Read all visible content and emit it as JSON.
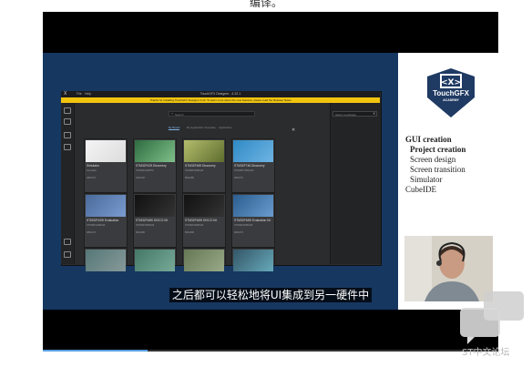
{
  "top_caption": "编译。",
  "video": {
    "progress": 0.23
  },
  "app": {
    "title": "TouchGFX Designer - 4.22.1",
    "logo": "X",
    "menu": [
      "File",
      "Help"
    ],
    "banner": "Thanks for installing TouchGFX Designer 4.22. To learn more about the new features, please read the Release Notes",
    "search_placeholder": "Search",
    "right_search_placeholder": "Select a package",
    "tabs": [
      "By Board",
      "By Application Template",
      "Application"
    ],
    "close_glyph": "✕",
    "cards": [
      {
        "title": "Simulator",
        "lines": [
          "Simulator",
          "",
          "480x272"
        ]
      },
      {
        "title": "STM32F429 Discovery",
        "lines": [
          "STM32F429ZIT6",
          "",
          "240x320"
        ]
      },
      {
        "title": "STM32F469 Discovery",
        "lines": [
          "STM32F469NIH6",
          "",
          "800x480"
        ]
      },
      {
        "title": "STM32F746 Discovery",
        "lines": [
          "STM32F746NGH6",
          "",
          "480x272"
        ]
      },
      {
        "title": "STM32F429I Evaluation",
        "lines": [
          "STM32F429NIH6",
          "",
          "480x272"
        ]
      },
      {
        "title": "STM32F469I DISCO Kit",
        "lines": [
          "STM32F469NIH6",
          "",
          "800x480"
        ]
      },
      {
        "title": "STM32F469I DISCO Kit",
        "lines": [
          "STM32F469NIH6",
          "",
          "800x480"
        ]
      },
      {
        "title": "STM32F469I Evaluation Kit",
        "lines": [
          "STM32F469NIH6",
          "",
          "480x272"
        ]
      },
      {
        "title": "",
        "lines": []
      },
      {
        "title": "",
        "lines": []
      },
      {
        "title": "",
        "lines": []
      },
      {
        "title": "",
        "lines": []
      }
    ]
  },
  "academy": {
    "logo_title": "TouchGFX",
    "logo_subtitle": "ACADEMY",
    "menu": [
      {
        "label": "GUI creation",
        "bold": true,
        "indent": 0
      },
      {
        "label": "Project creation",
        "bold": true,
        "indent": 1
      },
      {
        "label": "Screen design",
        "bold": false,
        "indent": 1
      },
      {
        "label": "Screen transition",
        "bold": false,
        "indent": 1
      },
      {
        "label": "Simulator",
        "bold": false,
        "indent": 1
      },
      {
        "label": "CubeIDE",
        "bold": false,
        "indent": 0
      }
    ]
  },
  "subtitle": "之后都可以轻松地将UI集成到另一硬件中",
  "watermark": "ST中文论坛",
  "colors": {
    "slide_bg": "#163760",
    "banner": "#f1c40f",
    "accent": "#5a9fe0"
  }
}
